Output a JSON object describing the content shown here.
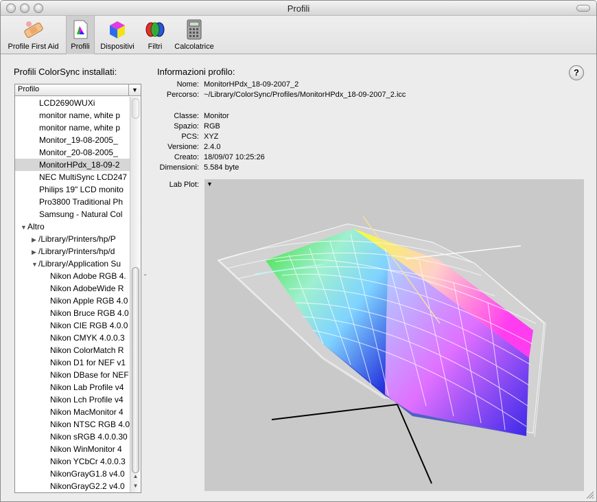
{
  "window": {
    "title": "Profili"
  },
  "toolbar": {
    "items": [
      {
        "label": "Profile First Aid",
        "icon": "first-aid-icon"
      },
      {
        "label": "Profili",
        "icon": "profiles-icon",
        "selected": true
      },
      {
        "label": "Dispositivi",
        "icon": "devices-icon"
      },
      {
        "label": "Filtri",
        "icon": "filters-icon"
      },
      {
        "label": "Calcolatrice",
        "icon": "calculator-icon"
      }
    ]
  },
  "sidebar": {
    "title": "Profili ColorSync installati:",
    "column_header": "Profilo",
    "rows": [
      "LCD2690WUXi",
      "monitor name, white p",
      "monitor name, white p",
      "Monitor_19-08-2005_",
      "Monitor_20-08-2005_",
      "MonitorHPdx_18-09-2",
      "NEC MultiSync LCD247",
      "Philips 19\" LCD monito",
      "Pro3800 Traditional Ph",
      "Samsung - Natural Col",
      "Altro",
      "/Library/Printers/hp/P",
      "/Library/Printers/hp/d",
      "/Library/Application Su",
      "Nikon Adobe RGB 4.",
      "Nikon AdobeWide R",
      "Nikon Apple RGB 4.0",
      "Nikon Bruce RGB 4.0",
      "Nikon CIE RGB 4.0.0",
      "Nikon CMYK 4.0.0.3",
      "Nikon ColorMatch R",
      "Nikon D1 for NEF v1",
      "Nikon DBase for NEF",
      "Nikon Lab Profile v4",
      "Nikon Lch Profile v4",
      "Nikon MacMonitor 4",
      "Nikon NTSC RGB 4.0",
      "Nikon sRGB 4.0.0.30",
      "Nikon WinMonitor 4",
      "Nikon YCbCr 4.0.0.3",
      "NikonGrayG1.8 v4.0",
      "NikonGrayG2.2 v4.0"
    ],
    "selected_index": 5,
    "disclosure": {
      "10": "open",
      "11": "closed",
      "12": "closed",
      "13": "open"
    },
    "indent": {
      "0": 1,
      "10": 0,
      "11": 1,
      "12": 1,
      "13": 1,
      "14": 2
    }
  },
  "info": {
    "title": "Informazioni profilo:",
    "fields": [
      {
        "label": "Nome:",
        "value": "MonitorHPdx_18-09-2007_2"
      },
      {
        "label": "Percorso:",
        "value": "~/Library/ColorSync/Profiles/MonitorHPdx_18-09-2007_2.icc"
      },
      {
        "label": "Classe:",
        "value": "Monitor"
      },
      {
        "label": "Spazio:",
        "value": "RGB"
      },
      {
        "label": "PCS:",
        "value": "XYZ"
      },
      {
        "label": "Versione:",
        "value": "2.4.0"
      },
      {
        "label": "Creato:",
        "value": "18/09/07 10:25:26"
      },
      {
        "label": "Dimensioni:",
        "value": "5.584 byte"
      }
    ],
    "plot_label": "Lab Plot:",
    "help": "?"
  },
  "colors": {
    "selection": "#d6d6d6",
    "plot_bg": "#c9c9c9"
  }
}
